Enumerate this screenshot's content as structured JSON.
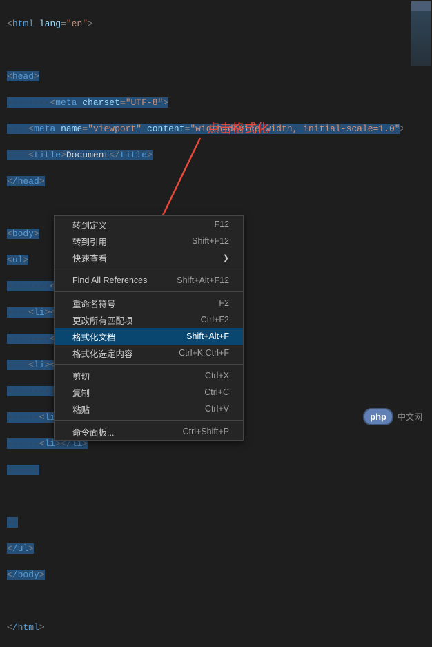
{
  "annotation_text": "点击格式化",
  "code": {
    "l1": {
      "tag": "html",
      "attr": "lang",
      "val": "\"en\""
    },
    "l2": {
      "tag": "head"
    },
    "l3": {
      "tag": "meta",
      "attr": "charset",
      "val": "\"UTF-8\""
    },
    "l4": {
      "tag": "meta",
      "a1": "name",
      "v1": "\"viewport\"",
      "a2": "content",
      "v2": "\"width=device-width, initial-scale=1.0\""
    },
    "l5": {
      "tag": "title",
      "text": "Document"
    },
    "l6": {
      "tag": "/head"
    },
    "l7": {
      "tag": "body"
    },
    "l8": {
      "tag": "ul"
    },
    "l9": {
      "tag": "li"
    },
    "l10": {
      "tag": "li"
    },
    "l11": {
      "tag": "li"
    },
    "l12": {
      "tag": "li"
    },
    "l13": {
      "tag": "li"
    },
    "l14": {
      "tag": "li"
    },
    "l15": {
      "tag": "li"
    },
    "l16": {
      "tag": "/ul"
    },
    "l17": {
      "tag": "/body"
    },
    "l18": {
      "tag": "/html"
    }
  },
  "ws": {
    "d2": "··",
    "d4": "····",
    "d6": "······",
    "d8": "········",
    "d10": "··········",
    "d12": "············"
  },
  "menu": {
    "goto_def": "转到定义",
    "goto_def_sc": "F12",
    "goto_ref": "转到引用",
    "goto_ref_sc": "Shift+F12",
    "quick_look": "快速查看",
    "find_refs": "Find All References",
    "find_refs_sc": "Shift+Alt+F12",
    "rename": "重命名符号",
    "rename_sc": "F2",
    "change_all": "更改所有匹配项",
    "change_all_sc": "Ctrl+F2",
    "format_doc": "格式化文档",
    "format_doc_sc": "Shift+Alt+F",
    "format_sel": "格式化选定内容",
    "format_sel_sc": "Ctrl+K Ctrl+F",
    "cut": "剪切",
    "cut_sc": "Ctrl+X",
    "copy": "复制",
    "copy_sc": "Ctrl+C",
    "paste": "粘贴",
    "paste_sc": "Ctrl+V",
    "cmd_palette": "命令面板...",
    "cmd_palette_sc": "Ctrl+Shift+P"
  },
  "watermark": {
    "badge": "php",
    "text": "中文网"
  }
}
